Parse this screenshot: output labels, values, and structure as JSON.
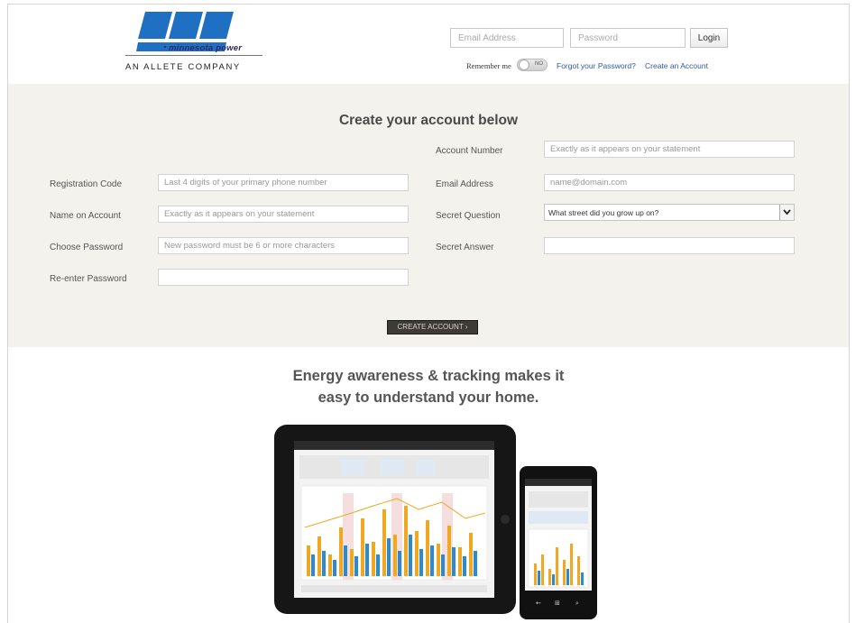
{
  "brand": {
    "name": "minnesota power",
    "tagline": "AN ALLETE COMPANY",
    "colors": {
      "primary": "#1f6fc2",
      "dark": "#2b2b6b"
    }
  },
  "login": {
    "email_placeholder": "Email Address",
    "password_placeholder": "Password",
    "login_label": "Login",
    "remember_label": "Remember me",
    "toggle_state": "NO",
    "forgot_link": "Forgot your Password?",
    "create_link": "Create an Account"
  },
  "registration": {
    "title": "Create your account below",
    "left_fields": [
      {
        "label": "Registration Code",
        "placeholder": "Last 4 digits of your primary phone number"
      },
      {
        "label": "Name on Account",
        "placeholder": "Exactly as it appears on your statement"
      },
      {
        "label": "Choose Password",
        "placeholder": "New password must be 6 or more characters"
      },
      {
        "label": "Re-enter Password",
        "placeholder": ""
      }
    ],
    "right_fields": [
      {
        "label": "Account Number",
        "placeholder": "Exactly as it appears on your statement"
      },
      {
        "label": "Email Address",
        "placeholder": "name@domain.com"
      },
      {
        "label": "Secret Question",
        "selected": "What street did you grow up on?"
      },
      {
        "label": "Secret Answer",
        "placeholder": ""
      }
    ],
    "submit_label": "CREATE ACCOUNT"
  },
  "promo": {
    "line1": "Energy awareness & tracking makes it",
    "line2": "easy to understand your home."
  }
}
